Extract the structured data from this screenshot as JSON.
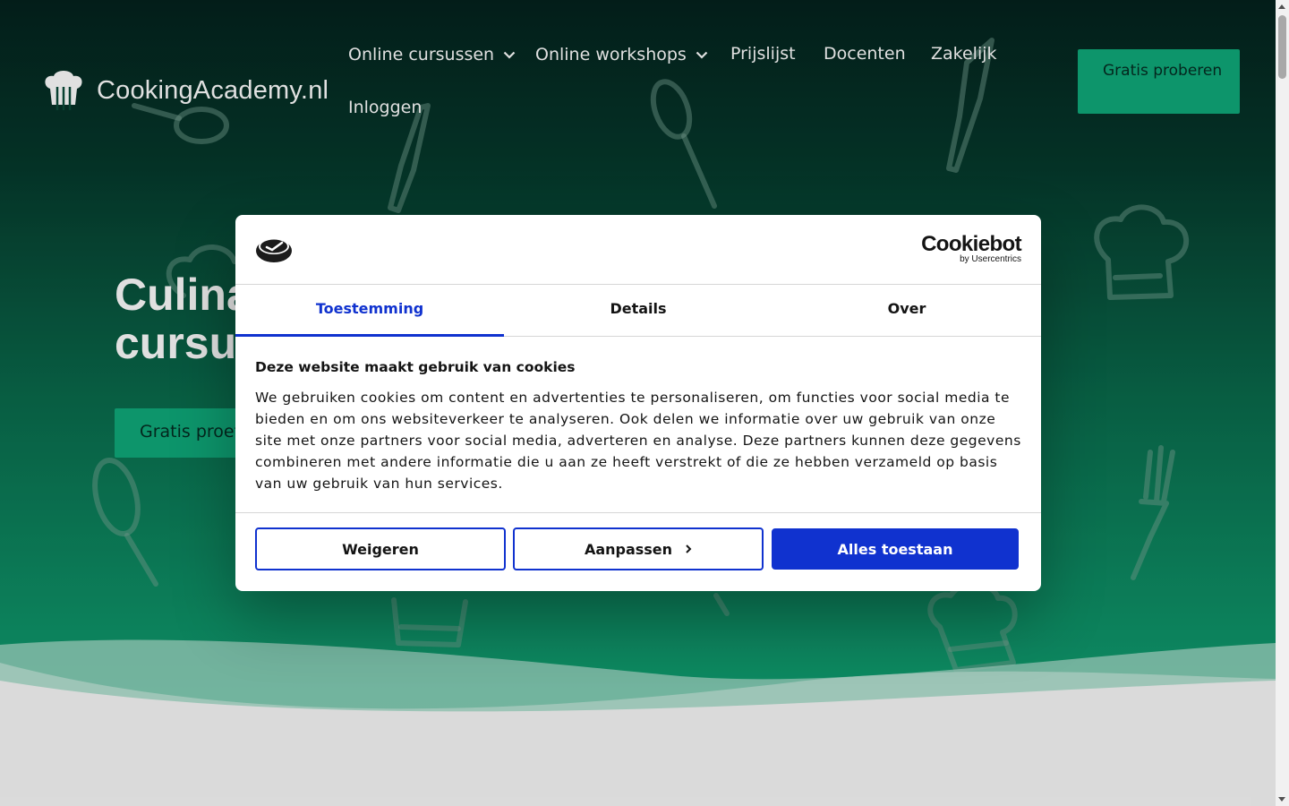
{
  "header": {
    "logo_text": "CookingAcademy.nl",
    "logo_icon": "chef-hat-cutlery-icon",
    "nav": [
      {
        "label": "Online cursussen",
        "has_dropdown": true
      },
      {
        "label": "Online workshops",
        "has_dropdown": true
      },
      {
        "label": "Prijslijst",
        "has_dropdown": false
      },
      {
        "label": "Docenten",
        "has_dropdown": false
      },
      {
        "label": "Zakelijk",
        "has_dropdown": false
      },
      {
        "label": "Inloggen",
        "has_dropdown": false
      }
    ],
    "cta_label": "Gratis proberen"
  },
  "hero": {
    "title_line1": "Culina",
    "title_line2": "cursus",
    "button_label": "Gratis proef"
  },
  "cookie_dialog": {
    "brand_icon": "cookiebot-logo-icon",
    "vendor_name": "Cookiebot",
    "vendor_sub": "by Usercentrics",
    "tabs": [
      {
        "label": "Toestemming",
        "active": true
      },
      {
        "label": "Details",
        "active": false
      },
      {
        "label": "Over",
        "active": false
      }
    ],
    "heading": "Deze website maakt gebruik van cookies",
    "body": "We gebruiken cookies om content en advertenties te personaliseren, om functies voor social media te bieden en om ons websiteverkeer te analyseren. Ook delen we informatie over uw gebruik van onze site met onze partners voor social media, adverteren en analyse. Deze partners kunnen deze gegevens combineren met andere informatie die u aan ze heeft verstrekt of die ze hebben verzameld op basis van uw gebruik van hun services.",
    "buttons": {
      "deny": "Weigeren",
      "customize": "Aanpassen",
      "allow_all": "Alles toestaan"
    }
  },
  "colors": {
    "brand_green": "#0faa7a",
    "hero_dark": "#04221d",
    "dialog_accent": "#1032cf"
  }
}
